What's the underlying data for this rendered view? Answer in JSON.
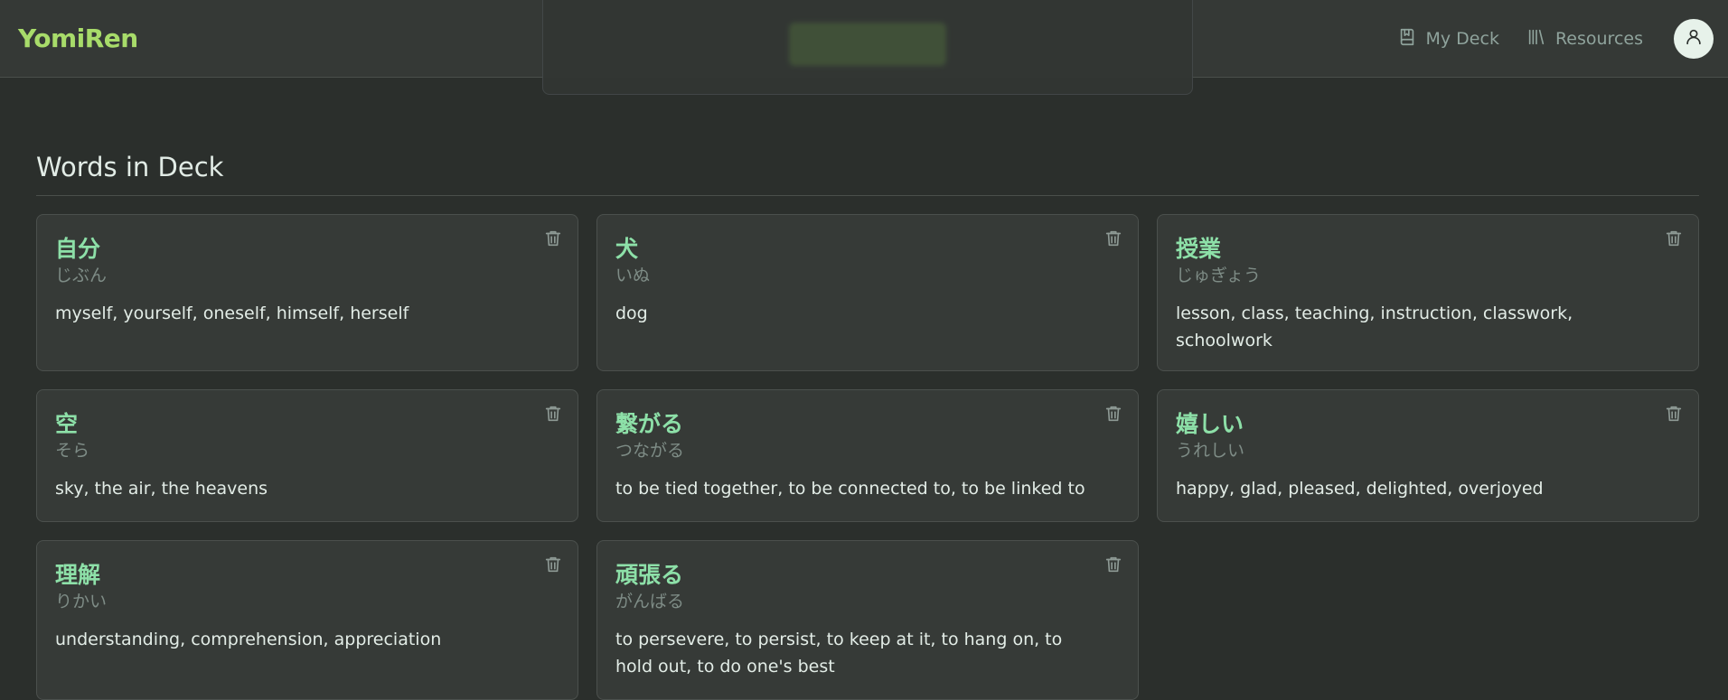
{
  "app": {
    "name": "YomiRen"
  },
  "nav": {
    "my_deck": "My Deck",
    "resources": "Resources"
  },
  "section": {
    "title": "Words in Deck"
  },
  "cards": [
    {
      "word": "自分",
      "reading": "じぶん",
      "meaning": "myself, yourself, oneself, himself, herself"
    },
    {
      "word": "犬",
      "reading": "いぬ",
      "meaning": "dog"
    },
    {
      "word": "授業",
      "reading": "じゅぎょう",
      "meaning": "lesson, class, teaching, instruction, classwork, schoolwork"
    },
    {
      "word": "空",
      "reading": "そら",
      "meaning": "sky, the air, the heavens"
    },
    {
      "word": "繋がる",
      "reading": "つながる",
      "meaning": "to be tied together, to be connected to, to be linked to"
    },
    {
      "word": "嬉しい",
      "reading": "うれしい",
      "meaning": "happy, glad, pleased, delighted, overjoyed"
    },
    {
      "word": "理解",
      "reading": "りかい",
      "meaning": "understanding, comprehension, appreciation"
    },
    {
      "word": "頑張る",
      "reading": "がんばる",
      "meaning": "to persevere, to persist, to keep at it, to hang on, to hold out, to do one's best"
    }
  ],
  "icons": {
    "my_deck": "book-bookmark-icon",
    "resources": "library-icon",
    "avatar": "user-icon",
    "delete": "trash-icon"
  },
  "colors": {
    "brand": "#a8dc6a",
    "word": "#8de0a8",
    "background": "#2b2f2c"
  }
}
